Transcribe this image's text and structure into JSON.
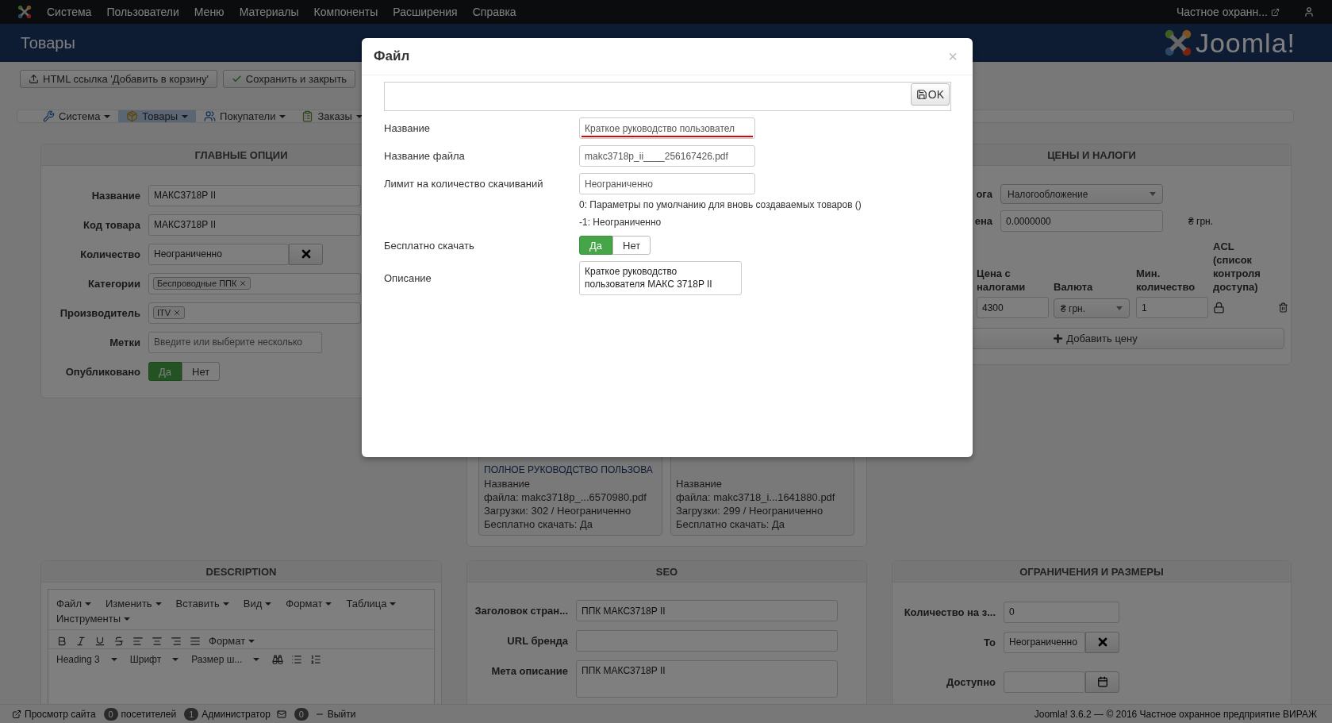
{
  "top_menu": {
    "items": [
      "Система",
      "Пользователи",
      "Меню",
      "Материалы",
      "Компоненты",
      "Расширения",
      "Справка"
    ],
    "site_link": "Частное охранн..."
  },
  "header": {
    "title": "Товары",
    "logo_text": "Joomla!"
  },
  "toolbar": {
    "buttons": [
      {
        "label": "HTML ссылка 'Добавить в корзину'",
        "kind": "upload"
      },
      {
        "label": "Сохранить и закрыть",
        "kind": "check"
      }
    ]
  },
  "subnav": {
    "tabs": [
      {
        "label": "Система",
        "kind": "tools",
        "selected": false
      },
      {
        "label": "Товары",
        "kind": "box",
        "selected": true
      },
      {
        "label": "Покупатели",
        "kind": "users",
        "selected": false
      },
      {
        "label": "Заказы",
        "kind": "orders",
        "selected": false
      }
    ]
  },
  "main_options": {
    "title": "ГЛАВНЫЕ ОПЦИИ",
    "fields": [
      {
        "label": "Название",
        "kind": "text",
        "value": "МАКС3718P II"
      },
      {
        "label": "Код товара",
        "kind": "text",
        "value": "МАКС3718P II"
      },
      {
        "label": "Количество",
        "kind": "clearable",
        "value": "Неограниченно"
      },
      {
        "label": "Категории",
        "kind": "tags",
        "tags": [
          "Беспроводные ППК"
        ]
      },
      {
        "label": "Производитель",
        "kind": "tags",
        "tags": [
          "ITV"
        ]
      },
      {
        "label": "Метки",
        "kind": "text",
        "placeholder": "Введите или выберите несколько"
      },
      {
        "label": "Опубликовано",
        "kind": "toggle",
        "options": [
          {
            "label": "Да",
            "selected": true
          },
          {
            "label": "Нет",
            "selected": false
          }
        ]
      }
    ]
  },
  "files": {
    "cards": [
      {
        "title": "ПОЛНОЕ РУКОВОДСТВО ПОЛЬЗОВА",
        "lines": [
          "Название файла: makc3718p_...6570980.pdf",
          "Загрузки: 302 / Неограниченно",
          "Бесплатно скачать: Да"
        ]
      },
      {
        "lines": [
          "Название файла: makc3718_i...1641880.pdf",
          "Загрузки: 299 / Неограниченно",
          "Бесплатно скачать: Да"
        ]
      }
    ]
  },
  "prices": {
    "title": "ЦЕНЫ И НАЛОГИ",
    "tax_label": "ога",
    "tax_select": "Налогообложение",
    "price_label": "ена",
    "price_value": "0.0000000",
    "currency_suffix": "₴ грн.",
    "columns": [
      "Цена с налогами",
      "Валюта",
      "Мин. количество",
      "ACL (список контроля доступа)"
    ],
    "rows": [
      {
        "price": "4300",
        "currency": "₴ грн.",
        "min_qty": "1"
      }
    ],
    "add_button": "Добавить цену"
  },
  "description": {
    "title": "DESCRIPTION",
    "menu": [
      "Файл",
      "Изменить",
      "Вставить",
      "Вид",
      "Формат",
      "Таблица",
      "Инструменты"
    ],
    "format_button": "Формат",
    "block_select": "Heading 3",
    "font_select": "Шрифт",
    "size_select": "Размер ш..."
  },
  "seo": {
    "title": "SEO",
    "fields": [
      {
        "label": "Заголовок стран...",
        "kind": "input",
        "value": "ППК МАКС3718P II"
      },
      {
        "label": "URL бренда",
        "kind": "input"
      },
      {
        "label": "Мета описание",
        "kind": "textarea",
        "value": "ППК МАКС3718P II"
      }
    ]
  },
  "limits": {
    "title": "ОГРАНИЧЕНИЯ И РАЗМЕРЫ",
    "fields": [
      {
        "label": "Количество на з...",
        "kind": "input",
        "value": "0"
      },
      {
        "label": "То",
        "kind": "clearable",
        "value": "Неограниченно"
      },
      {
        "label": "Доступно",
        "kind": "date"
      }
    ]
  },
  "footer": {
    "view_site": "Просмотр сайта",
    "visitors_count": "0",
    "visitors": "посетителей",
    "admins_count": "1",
    "admins": "Администратор",
    "messages_count": "0",
    "logout": "Выйти",
    "copyright": "Joomla! 3.6.2 — © 2016 Частное охранное предприятие ВИРАЖ"
  },
  "modal": {
    "title": "Файл",
    "close": "×",
    "ok_button": "OK",
    "fields": [
      {
        "label": "Название",
        "kind": "input",
        "value": "Краткое руководство пользовател",
        "spellcheck_error": true
      },
      {
        "label": "Название файла",
        "kind": "input",
        "value": "makc3718p_ii____256167426.pdf"
      },
      {
        "label": "Лимит на количество скачиваний",
        "kind": "input",
        "value": "Неограниченно",
        "help": [
          "0: Параметры по умолчанию для вновь создаваемых товаров ()",
          "-1: Неограниченно"
        ]
      },
      {
        "label": "Бесплатно скачать",
        "kind": "toggle",
        "options": [
          {
            "label": "Да",
            "selected": true
          },
          {
            "label": "Нет",
            "selected": false
          }
        ]
      },
      {
        "label": "Описание",
        "kind": "textarea",
        "value": "Краткое руководство пользователя МАКС 3718P II"
      }
    ]
  }
}
